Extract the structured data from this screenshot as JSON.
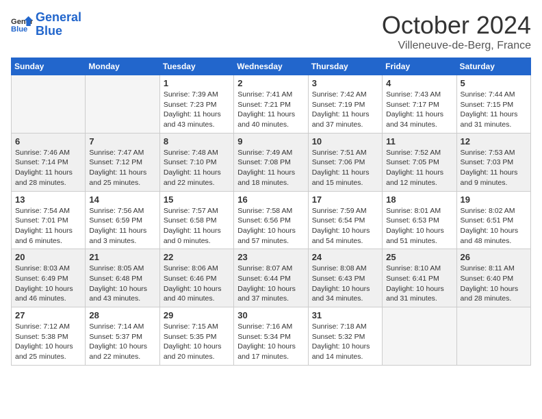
{
  "header": {
    "logo_line1": "General",
    "logo_line2": "Blue",
    "month": "October 2024",
    "location": "Villeneuve-de-Berg, France"
  },
  "days_of_week": [
    "Sunday",
    "Monday",
    "Tuesday",
    "Wednesday",
    "Thursday",
    "Friday",
    "Saturday"
  ],
  "weeks": [
    [
      {
        "day": "",
        "info": ""
      },
      {
        "day": "",
        "info": ""
      },
      {
        "day": "1",
        "info": "Sunrise: 7:39 AM\nSunset: 7:23 PM\nDaylight: 11 hours and 43 minutes."
      },
      {
        "day": "2",
        "info": "Sunrise: 7:41 AM\nSunset: 7:21 PM\nDaylight: 11 hours and 40 minutes."
      },
      {
        "day": "3",
        "info": "Sunrise: 7:42 AM\nSunset: 7:19 PM\nDaylight: 11 hours and 37 minutes."
      },
      {
        "day": "4",
        "info": "Sunrise: 7:43 AM\nSunset: 7:17 PM\nDaylight: 11 hours and 34 minutes."
      },
      {
        "day": "5",
        "info": "Sunrise: 7:44 AM\nSunset: 7:15 PM\nDaylight: 11 hours and 31 minutes."
      }
    ],
    [
      {
        "day": "6",
        "info": "Sunrise: 7:46 AM\nSunset: 7:14 PM\nDaylight: 11 hours and 28 minutes."
      },
      {
        "day": "7",
        "info": "Sunrise: 7:47 AM\nSunset: 7:12 PM\nDaylight: 11 hours and 25 minutes."
      },
      {
        "day": "8",
        "info": "Sunrise: 7:48 AM\nSunset: 7:10 PM\nDaylight: 11 hours and 22 minutes."
      },
      {
        "day": "9",
        "info": "Sunrise: 7:49 AM\nSunset: 7:08 PM\nDaylight: 11 hours and 18 minutes."
      },
      {
        "day": "10",
        "info": "Sunrise: 7:51 AM\nSunset: 7:06 PM\nDaylight: 11 hours and 15 minutes."
      },
      {
        "day": "11",
        "info": "Sunrise: 7:52 AM\nSunset: 7:05 PM\nDaylight: 11 hours and 12 minutes."
      },
      {
        "day": "12",
        "info": "Sunrise: 7:53 AM\nSunset: 7:03 PM\nDaylight: 11 hours and 9 minutes."
      }
    ],
    [
      {
        "day": "13",
        "info": "Sunrise: 7:54 AM\nSunset: 7:01 PM\nDaylight: 11 hours and 6 minutes."
      },
      {
        "day": "14",
        "info": "Sunrise: 7:56 AM\nSunset: 6:59 PM\nDaylight: 11 hours and 3 minutes."
      },
      {
        "day": "15",
        "info": "Sunrise: 7:57 AM\nSunset: 6:58 PM\nDaylight: 11 hours and 0 minutes."
      },
      {
        "day": "16",
        "info": "Sunrise: 7:58 AM\nSunset: 6:56 PM\nDaylight: 10 hours and 57 minutes."
      },
      {
        "day": "17",
        "info": "Sunrise: 7:59 AM\nSunset: 6:54 PM\nDaylight: 10 hours and 54 minutes."
      },
      {
        "day": "18",
        "info": "Sunrise: 8:01 AM\nSunset: 6:53 PM\nDaylight: 10 hours and 51 minutes."
      },
      {
        "day": "19",
        "info": "Sunrise: 8:02 AM\nSunset: 6:51 PM\nDaylight: 10 hours and 48 minutes."
      }
    ],
    [
      {
        "day": "20",
        "info": "Sunrise: 8:03 AM\nSunset: 6:49 PM\nDaylight: 10 hours and 46 minutes."
      },
      {
        "day": "21",
        "info": "Sunrise: 8:05 AM\nSunset: 6:48 PM\nDaylight: 10 hours and 43 minutes."
      },
      {
        "day": "22",
        "info": "Sunrise: 8:06 AM\nSunset: 6:46 PM\nDaylight: 10 hours and 40 minutes."
      },
      {
        "day": "23",
        "info": "Sunrise: 8:07 AM\nSunset: 6:44 PM\nDaylight: 10 hours and 37 minutes."
      },
      {
        "day": "24",
        "info": "Sunrise: 8:08 AM\nSunset: 6:43 PM\nDaylight: 10 hours and 34 minutes."
      },
      {
        "day": "25",
        "info": "Sunrise: 8:10 AM\nSunset: 6:41 PM\nDaylight: 10 hours and 31 minutes."
      },
      {
        "day": "26",
        "info": "Sunrise: 8:11 AM\nSunset: 6:40 PM\nDaylight: 10 hours and 28 minutes."
      }
    ],
    [
      {
        "day": "27",
        "info": "Sunrise: 7:12 AM\nSunset: 5:38 PM\nDaylight: 10 hours and 25 minutes."
      },
      {
        "day": "28",
        "info": "Sunrise: 7:14 AM\nSunset: 5:37 PM\nDaylight: 10 hours and 22 minutes."
      },
      {
        "day": "29",
        "info": "Sunrise: 7:15 AM\nSunset: 5:35 PM\nDaylight: 10 hours and 20 minutes."
      },
      {
        "day": "30",
        "info": "Sunrise: 7:16 AM\nSunset: 5:34 PM\nDaylight: 10 hours and 17 minutes."
      },
      {
        "day": "31",
        "info": "Sunrise: 7:18 AM\nSunset: 5:32 PM\nDaylight: 10 hours and 14 minutes."
      },
      {
        "day": "",
        "info": ""
      },
      {
        "day": "",
        "info": ""
      }
    ]
  ]
}
